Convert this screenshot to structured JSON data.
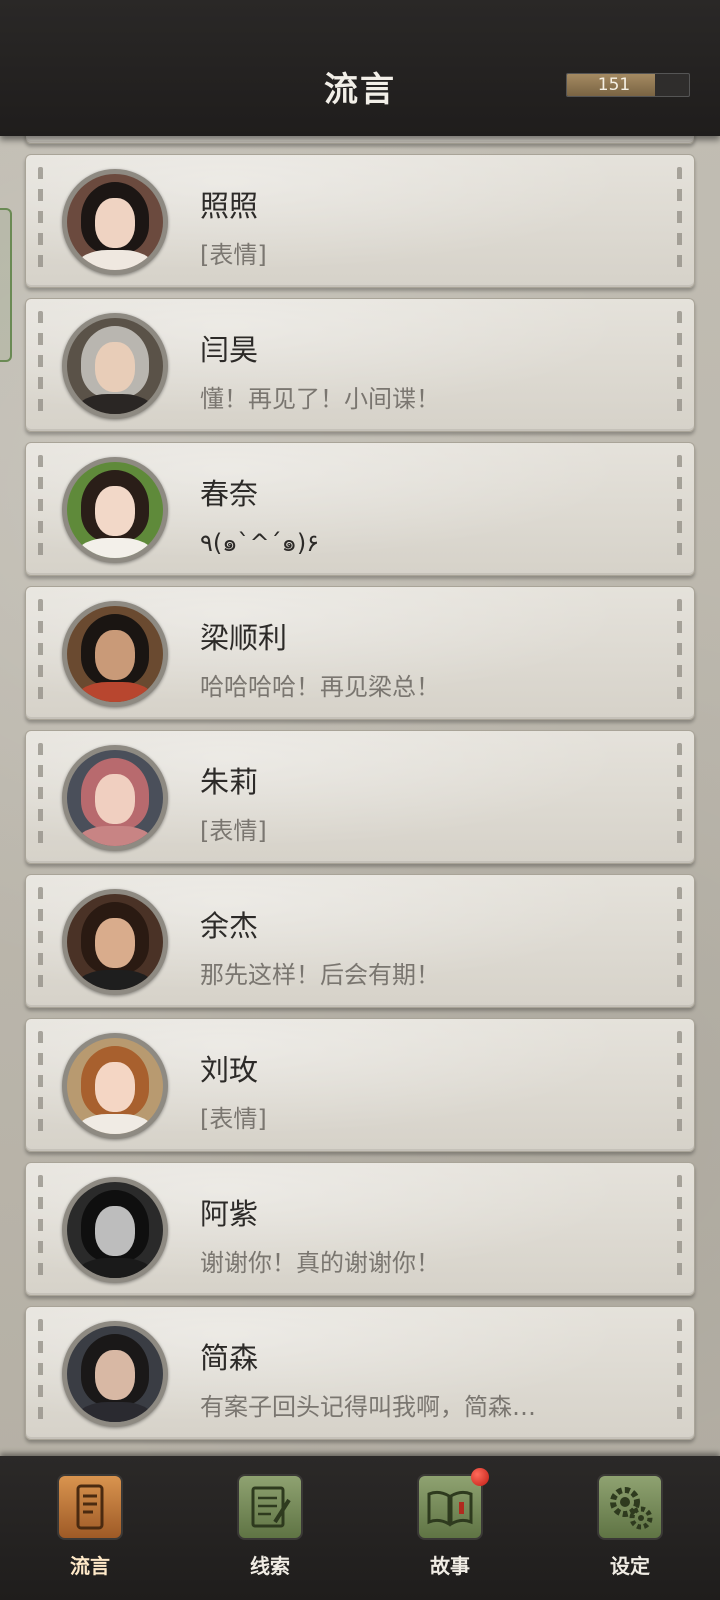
{
  "header": {
    "title": "流言",
    "counter_value": "151",
    "counter_fill": 0.72
  },
  "contacts": [
    {
      "name": "照照",
      "message": "[表情]"
    },
    {
      "name": "闫昊",
      "message": "懂！再见了！小间谍！"
    },
    {
      "name": "春奈",
      "message": "٩(๑`^´๑)۶"
    },
    {
      "name": "梁顺利",
      "message": "哈哈哈哈！再见梁总！"
    },
    {
      "name": "朱莉",
      "message": "[表情]"
    },
    {
      "name": "余杰",
      "message": "那先这样！后会有期！"
    },
    {
      "name": "刘玫",
      "message": "[表情]"
    },
    {
      "name": "阿紫",
      "message": "谢谢你！真的谢谢你！"
    },
    {
      "name": "简森",
      "message": "有案子回头记得叫我啊，简森…"
    }
  ],
  "nav": {
    "items": [
      {
        "label": "流言",
        "icon": "phone-icon",
        "active": true
      },
      {
        "label": "线索",
        "icon": "notepad-icon",
        "active": false
      },
      {
        "label": "故事",
        "icon": "book-icon",
        "active": false,
        "badge": true
      },
      {
        "label": "设定",
        "icon": "gear-icon",
        "active": false
      }
    ]
  }
}
